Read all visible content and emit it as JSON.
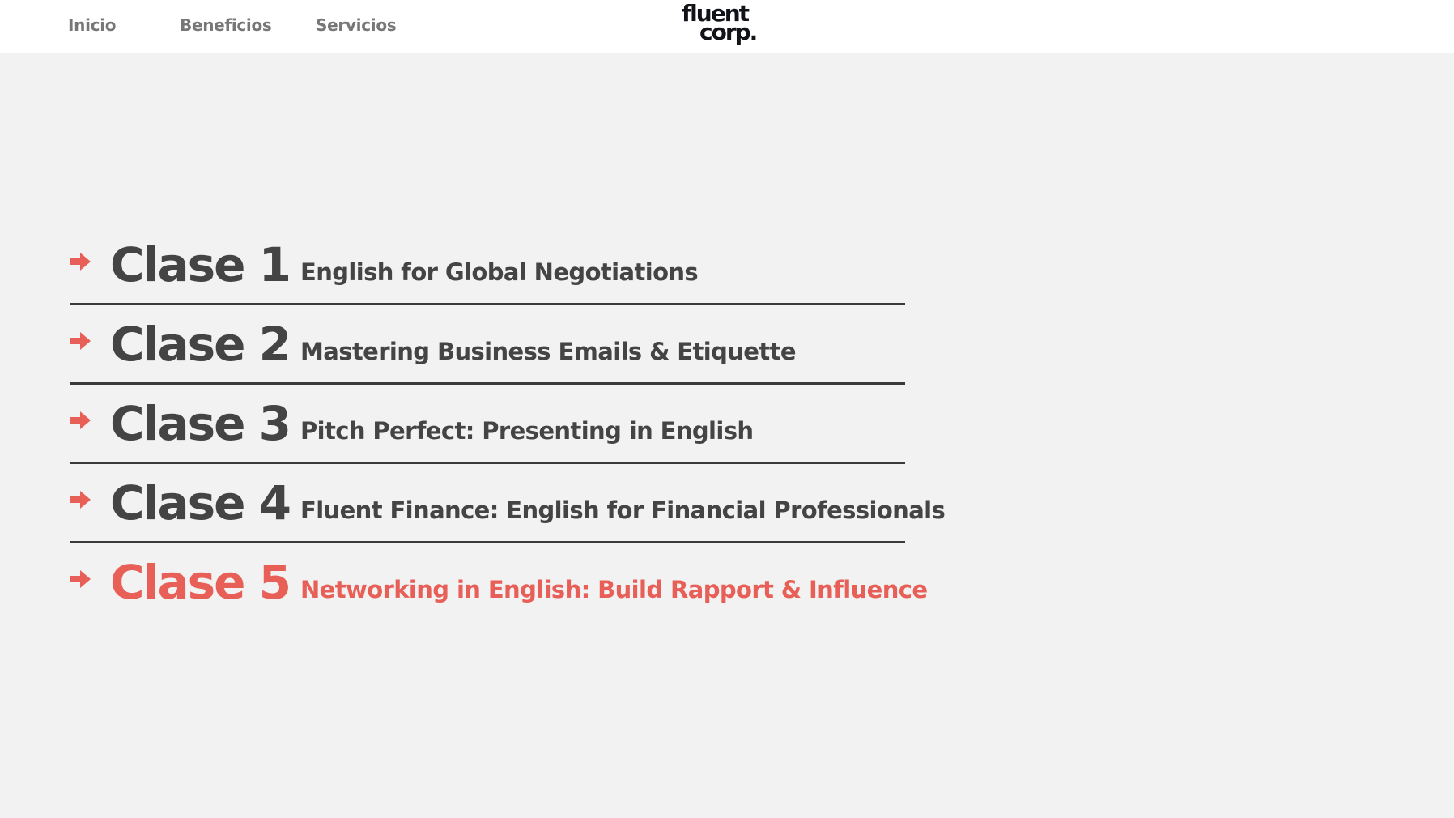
{
  "nav": {
    "items": [
      {
        "label": "Inicio"
      },
      {
        "label": "Beneficios"
      },
      {
        "label": "Servicios"
      }
    ]
  },
  "logo": {
    "line1": "fluent",
    "line2": "corp."
  },
  "classes": [
    {
      "number_label": "Clase 1",
      "title": "English for Global Negotiations",
      "active": false
    },
    {
      "number_label": "Clase 2",
      "title": "Mastering Business Emails & Etiquette",
      "active": false
    },
    {
      "number_label": "Clase 3",
      "title": "Pitch Perfect: Presenting in English",
      "active": false
    },
    {
      "number_label": "Clase 4",
      "title": "Fluent Finance: English for Financial Professionals",
      "active": false
    },
    {
      "number_label": "Clase 5",
      "title": "Networking in English: Build Rapport & Influence",
      "active": true
    }
  ],
  "colors": {
    "accent": "#e85f58",
    "text": "#444444",
    "nav_text": "#777777",
    "background": "#f2f2f2",
    "header_bg": "#ffffff",
    "divider": "#3a3a3a",
    "logo": "#111318"
  },
  "icons": {
    "row_marker": "arrow-right-icon"
  }
}
